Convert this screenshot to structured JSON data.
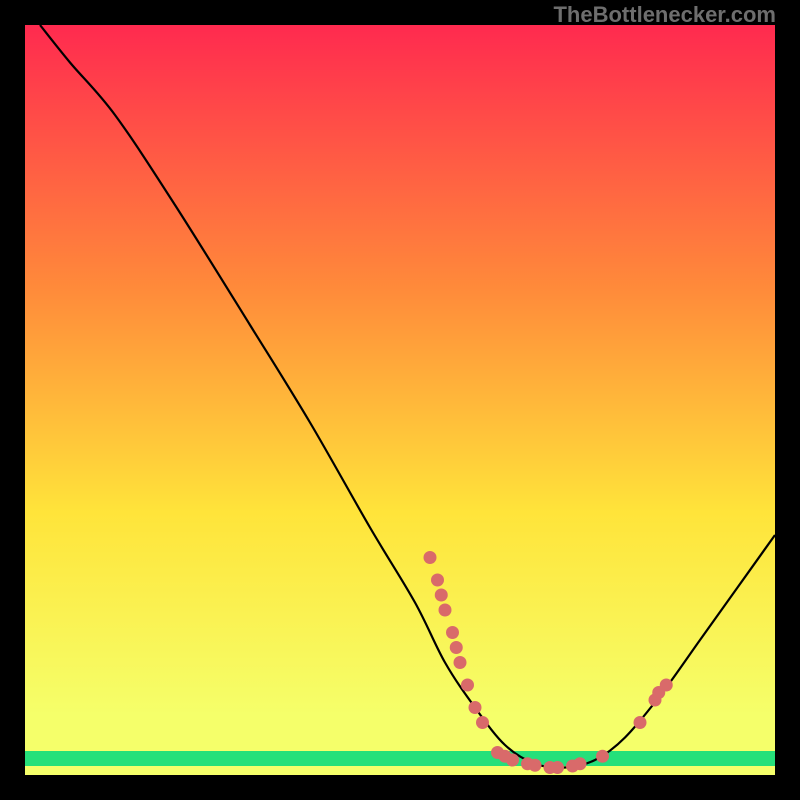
{
  "watermark": "TheBottlenecker.com",
  "chart_data": {
    "type": "line",
    "title": "",
    "xlabel": "",
    "ylabel": "",
    "xlim": [
      0,
      100
    ],
    "ylim": [
      0,
      100
    ],
    "background_gradient": {
      "top": "#ff2a4f",
      "mid_upper": "#ff8a3a",
      "mid": "#ffe43a",
      "lower": "#f5ff6a",
      "bottom_band": "#25e07a"
    },
    "curve": [
      {
        "x": 2,
        "y": 100
      },
      {
        "x": 6,
        "y": 95
      },
      {
        "x": 12,
        "y": 88
      },
      {
        "x": 20,
        "y": 76
      },
      {
        "x": 30,
        "y": 60
      },
      {
        "x": 38,
        "y": 47
      },
      {
        "x": 46,
        "y": 33
      },
      {
        "x": 52,
        "y": 23
      },
      {
        "x": 56,
        "y": 15
      },
      {
        "x": 60,
        "y": 9
      },
      {
        "x": 64,
        "y": 4
      },
      {
        "x": 68,
        "y": 1.5
      },
      {
        "x": 72,
        "y": 1
      },
      {
        "x": 76,
        "y": 2
      },
      {
        "x": 80,
        "y": 5
      },
      {
        "x": 85,
        "y": 11
      },
      {
        "x": 90,
        "y": 18
      },
      {
        "x": 95,
        "y": 25
      },
      {
        "x": 100,
        "y": 32
      }
    ],
    "scatter_points": [
      {
        "x": 54,
        "y": 29
      },
      {
        "x": 55,
        "y": 26
      },
      {
        "x": 55.5,
        "y": 24
      },
      {
        "x": 56,
        "y": 22
      },
      {
        "x": 57,
        "y": 19
      },
      {
        "x": 57.5,
        "y": 17
      },
      {
        "x": 58,
        "y": 15
      },
      {
        "x": 59,
        "y": 12
      },
      {
        "x": 60,
        "y": 9
      },
      {
        "x": 61,
        "y": 7
      },
      {
        "x": 63,
        "y": 3
      },
      {
        "x": 64,
        "y": 2.5
      },
      {
        "x": 65,
        "y": 2
      },
      {
        "x": 67,
        "y": 1.5
      },
      {
        "x": 68,
        "y": 1.3
      },
      {
        "x": 70,
        "y": 1
      },
      {
        "x": 71,
        "y": 1
      },
      {
        "x": 73,
        "y": 1.2
      },
      {
        "x": 74,
        "y": 1.5
      },
      {
        "x": 77,
        "y": 2.5
      },
      {
        "x": 82,
        "y": 7
      },
      {
        "x": 84,
        "y": 10
      },
      {
        "x": 84.5,
        "y": 11
      },
      {
        "x": 85.5,
        "y": 12
      }
    ],
    "point_color": "#d96a6a",
    "curve_color": "#000000"
  }
}
